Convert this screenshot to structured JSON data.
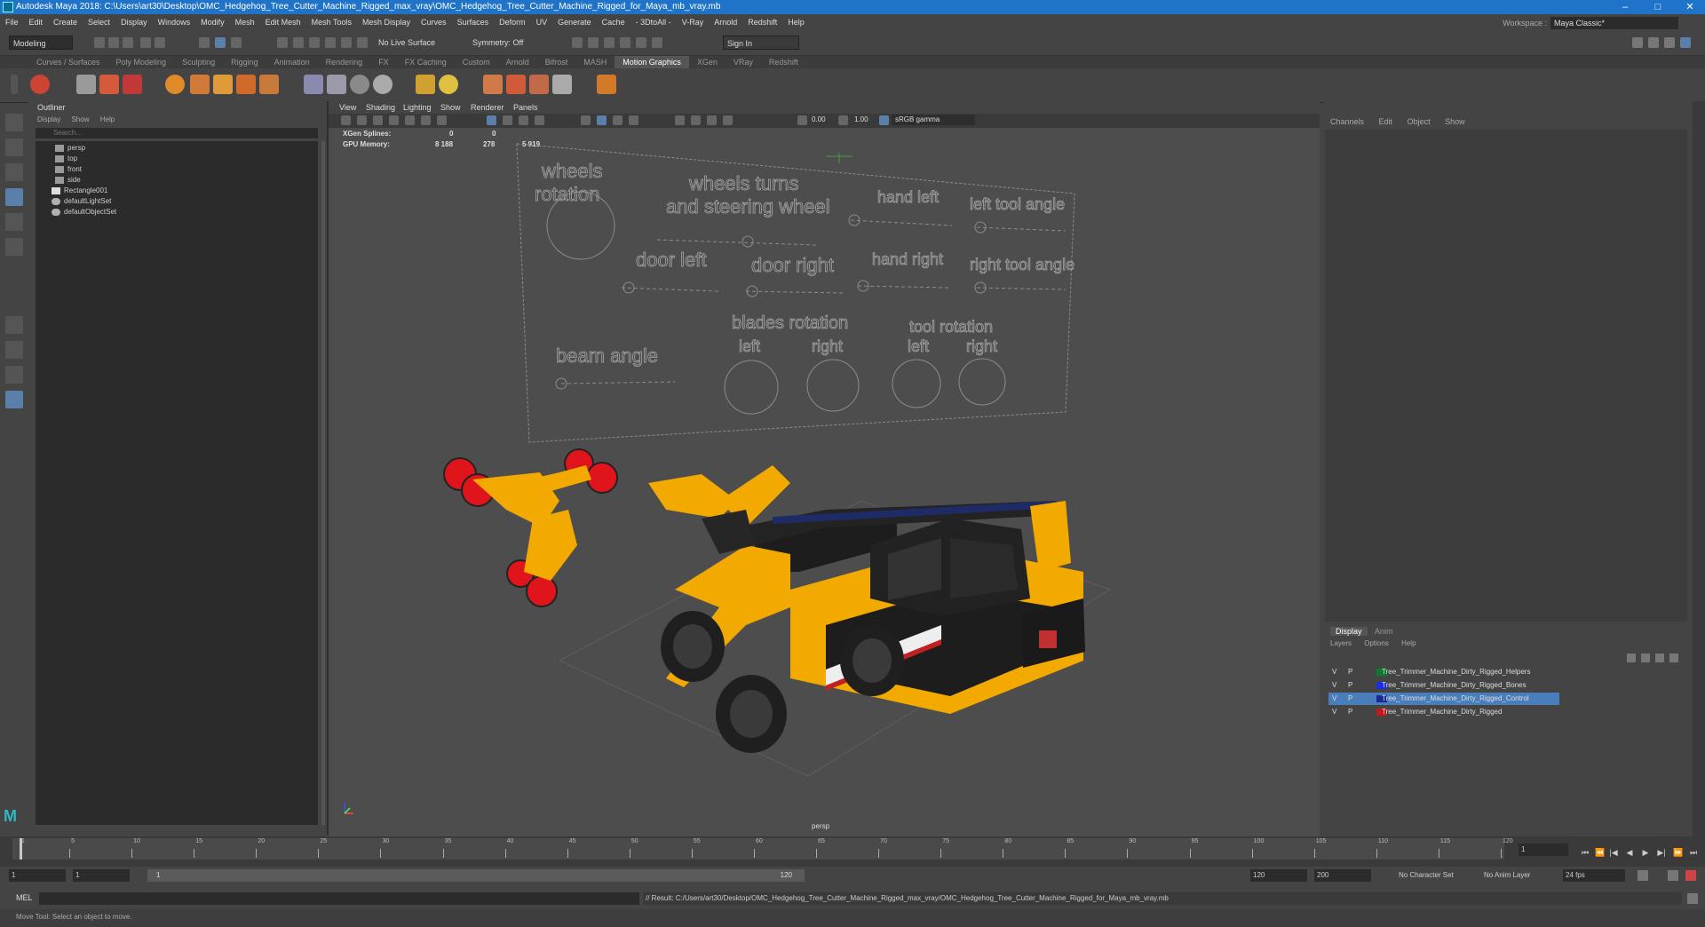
{
  "titlebar": {
    "title": "Autodesk Maya 2018: C:\\Users\\art30\\Desktop\\OMC_Hedgehog_Tree_Cutter_Machine_Rigged_max_vray\\OMC_Hedgehog_Tree_Cutter_Machine_Rigged_for_Maya_mb_vray.mb",
    "minimize": "–",
    "maximize": "□",
    "close": "✕"
  },
  "menubar": {
    "items": [
      "File",
      "Edit",
      "Create",
      "Select",
      "Display",
      "Windows",
      "Modify",
      "Mesh",
      "Edit Mesh",
      "Mesh Tools",
      "Mesh Display",
      "Curves",
      "Surfaces",
      "Deform",
      "UV",
      "Generate",
      "Cache",
      "- 3DtoAll -",
      "V-Ray",
      "Arnold",
      "Redshift",
      "Help"
    ],
    "workspace_label": "Workspace :",
    "workspace_value": "Maya Classic*"
  },
  "statusline": {
    "mode": "Modeling",
    "live_surface": "No Live Surface",
    "symmetry": "Symmetry: Off",
    "sign_in": "Sign In"
  },
  "shelf": {
    "tabs": [
      "Curves / Surfaces",
      "Poly Modeling",
      "Sculpting",
      "Rigging",
      "Animation",
      "Rendering",
      "FX",
      "FX Caching",
      "Custom",
      "Arnold",
      "Bifrost",
      "MASH",
      "Motion Graphics",
      "XGen",
      "VRay",
      "Redshift"
    ],
    "active_tab": "Motion Graphics"
  },
  "outliner": {
    "title": "Outliner",
    "menu": [
      "Display",
      "Show",
      "Help"
    ],
    "search_placeholder": "Search...",
    "items": [
      {
        "label": "persp",
        "icon": "camera-icon"
      },
      {
        "label": "top",
        "icon": "camera-icon"
      },
      {
        "label": "front",
        "icon": "camera-icon"
      },
      {
        "label": "side",
        "icon": "camera-icon"
      },
      {
        "label": "Rectangle001",
        "icon": "transform-icon"
      },
      {
        "label": "defaultLightSet",
        "icon": "set-icon"
      },
      {
        "label": "defaultObjectSet",
        "icon": "set-icon"
      }
    ]
  },
  "viewport": {
    "menu": [
      "View",
      "Shading",
      "Lighting",
      "Show",
      "Renderer",
      "Panels"
    ],
    "exposure": "0.00",
    "gamma": "1.00",
    "color_space": "sRGB gamma",
    "hud": {
      "xgen_label": "XGen Splines:",
      "xgen_v1": "0",
      "xgen_v2": "0",
      "gpu_label": "GPU Memory:",
      "gpu_v1": "8 188",
      "gpu_v2": "278",
      "gpu_v3": "5 919"
    },
    "camera_label": "persp",
    "control_panel": {
      "labels": [
        "wheels rotation",
        "wheels turns and steering wheel",
        "hand left",
        "left tool angle",
        "door left",
        "door right",
        "hand right",
        "right tool angle",
        "beam angle",
        "blades rotation",
        "left",
        "right",
        "tool rotation",
        "left",
        "right"
      ]
    }
  },
  "channelbox": {
    "menu": [
      "Channels",
      "Edit",
      "Object",
      "Show"
    ]
  },
  "layers": {
    "tabs": [
      "Display",
      "Anim"
    ],
    "active_tab": "Display",
    "menu": [
      "Layers",
      "Options",
      "Help"
    ],
    "rows": [
      {
        "v": "V",
        "p": "P",
        "name": "Tree_Trimmer_Machine_Dirty_Rigged_Helpers",
        "color": "#0e7a2e",
        "selected": false
      },
      {
        "v": "V",
        "p": "P",
        "name": "Tree_Trimmer_Machine_Dirty_Rigged_Bones",
        "color": "#1a2ee0",
        "selected": false
      },
      {
        "v": "V",
        "p": "P",
        "name": "Tree_Trimmer_Machine_Dirty_Rigged_Control",
        "color": "#1b2a9a",
        "selected": true
      },
      {
        "v": "V",
        "p": "P",
        "name": "Tree_Trimmer_Machine_Dirty_Rigged",
        "color": "#c01a1a",
        "selected": false
      }
    ]
  },
  "timeslider": {
    "current_frame": "1",
    "ticks": [
      "1",
      "5",
      "10",
      "15",
      "20",
      "25",
      "30",
      "35",
      "40",
      "45",
      "50",
      "55",
      "60",
      "65",
      "70",
      "75",
      "80",
      "85",
      "90",
      "95",
      "100",
      "105",
      "110",
      "115",
      "120"
    ]
  },
  "rangeslider": {
    "start": "1",
    "start2": "1",
    "range_start_label": "1",
    "range_end_label": "120",
    "end": "120",
    "end2": "200",
    "character_set": "No Character Set",
    "anim_layer": "No Anim Layer",
    "fps": "24 fps"
  },
  "cmdline": {
    "label": "MEL",
    "result": "// Result: C:/Users/art30/Desktop/OMC_Hedgehog_Tree_Cutter_Machine_Rigged_max_vray/OMC_Hedgehog_Tree_Cutter_Machine_Rigged_for_Maya_mb_vray.mb"
  },
  "helpline": {
    "text": "Move Tool: Select an object to move."
  },
  "colors": {
    "titlebar": "#1f74c9",
    "selected_layer": "#4a7ebb",
    "vehicle_yellow": "#f2a900",
    "vehicle_black": "#1d1d1d",
    "wheel_red": "#e0151b"
  }
}
